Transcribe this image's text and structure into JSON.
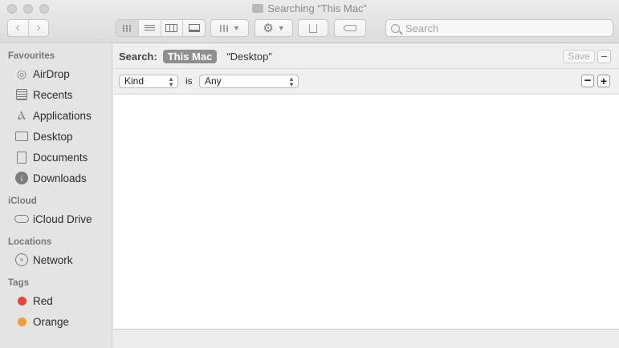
{
  "window": {
    "title": "Searching “This Mac”"
  },
  "toolbar": {
    "back_icon": "chevron-left-icon",
    "forward_icon": "chevron-right-icon",
    "search_placeholder": "Search",
    "search_value": ""
  },
  "sidebar": {
    "favourites": {
      "heading": "Favourites",
      "items": [
        {
          "label": "AirDrop",
          "icon": "airdrop-icon"
        },
        {
          "label": "Recents",
          "icon": "recents-icon"
        },
        {
          "label": "Applications",
          "icon": "applications-icon"
        },
        {
          "label": "Desktop",
          "icon": "desktop-icon"
        },
        {
          "label": "Documents",
          "icon": "documents-icon"
        },
        {
          "label": "Downloads",
          "icon": "downloads-icon"
        }
      ]
    },
    "icloud": {
      "heading": "iCloud",
      "items": [
        {
          "label": "iCloud Drive",
          "icon": "cloud-icon"
        }
      ]
    },
    "locations": {
      "heading": "Locations",
      "items": [
        {
          "label": "Network",
          "icon": "network-icon"
        }
      ]
    },
    "tags": {
      "heading": "Tags",
      "items": [
        {
          "label": "Red",
          "color": "#e8453c"
        },
        {
          "label": "Orange",
          "color": "#f29c38"
        }
      ]
    }
  },
  "search_bar": {
    "label": "Search:",
    "scope_active": "This Mac",
    "scope_other": "“Desktop”",
    "save_label": "Save",
    "remove_symbol": "−"
  },
  "criteria": {
    "attribute": "Kind",
    "operator": "is",
    "value": "Any",
    "remove_symbol": "−",
    "add_symbol": "+"
  }
}
